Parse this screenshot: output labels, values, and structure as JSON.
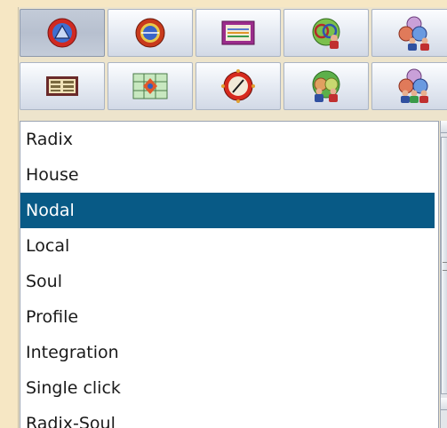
{
  "toolbar": {
    "row1": [
      {
        "icon": "radix-wheel-icon",
        "pressed": true
      },
      {
        "icon": "house-wheel-icon",
        "pressed": false
      },
      {
        "icon": "table-view-icon",
        "pressed": false
      },
      {
        "icon": "partner-chart-icon",
        "pressed": false
      },
      {
        "icon": "group-chart-icon",
        "pressed": false
      }
    ],
    "row2": [
      {
        "icon": "listing-icon",
        "pressed": false
      },
      {
        "icon": "aspect-grid-icon",
        "pressed": false
      },
      {
        "icon": "compass-dial-icon",
        "pressed": false
      },
      {
        "icon": "couple-chart-icon",
        "pressed": false
      },
      {
        "icon": "family-chart-icon",
        "pressed": false
      }
    ]
  },
  "chart_types": {
    "selected": "Nodal",
    "items": [
      "Radix",
      "House",
      "Nodal",
      "Local",
      "Soul",
      "Profile",
      "Integration",
      "Single click",
      "Radix-Soul"
    ]
  },
  "colors": {
    "selection": "#085a86",
    "background": "#f6e7c4"
  }
}
